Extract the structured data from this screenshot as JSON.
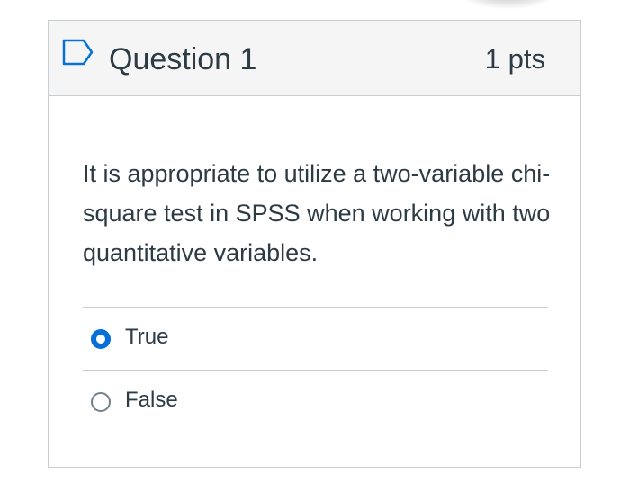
{
  "question": {
    "title": "Question 1",
    "points": "1 pts",
    "text": "It is appropriate to utilize a two-variable chi-square test in SPSS when working with two quantitative variables."
  },
  "answers": [
    {
      "label": "True",
      "selected": true
    },
    {
      "label": "False",
      "selected": false
    }
  ],
  "icons": {
    "flag": "flag-icon"
  },
  "colors": {
    "accent": "#0770d8",
    "header_bg": "#f5f5f5",
    "border": "#c7cdd1",
    "text": "#2d3b45"
  }
}
